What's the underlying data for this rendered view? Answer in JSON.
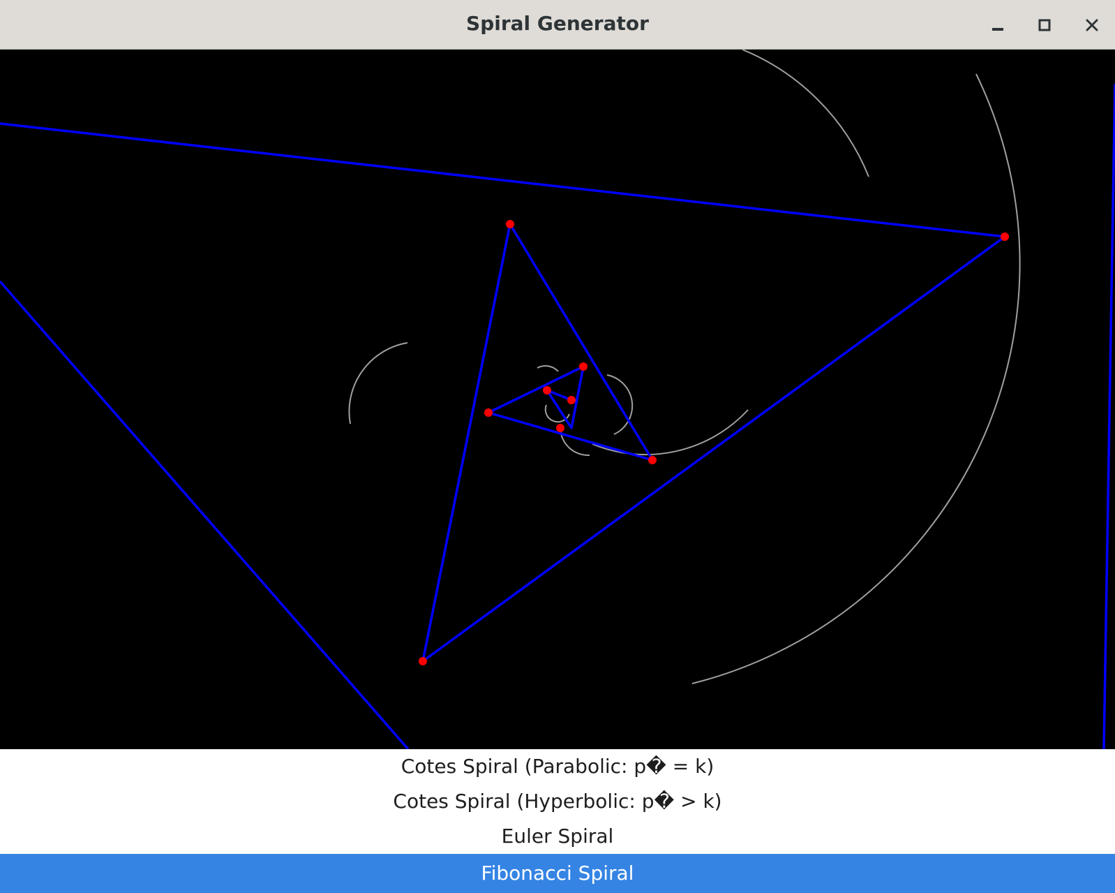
{
  "window": {
    "title": "Spiral Generator"
  },
  "spiral_list": {
    "items": [
      {
        "label": "Cotes Spiral (Parabolic: p� = k)",
        "selected": false
      },
      {
        "label": "Cotes Spiral (Hyperbolic: p� > k)",
        "selected": false
      },
      {
        "label": "Euler Spiral",
        "selected": false
      },
      {
        "label": "Fibonacci Spiral",
        "selected": true
      }
    ]
  },
  "colors": {
    "titlebar": "#dfdcd8",
    "canvas_background": "#000000",
    "polyline": "#0000ff",
    "vertex": "#ff0000",
    "arc": "#a0a0a0",
    "selection": "#3584e4",
    "list_text": "#1e1e1e",
    "selected_text": "#ffffff"
  },
  "icons": {
    "minimize": "minimize-icon",
    "maximize": "maximize-icon",
    "close": "close-icon"
  }
}
